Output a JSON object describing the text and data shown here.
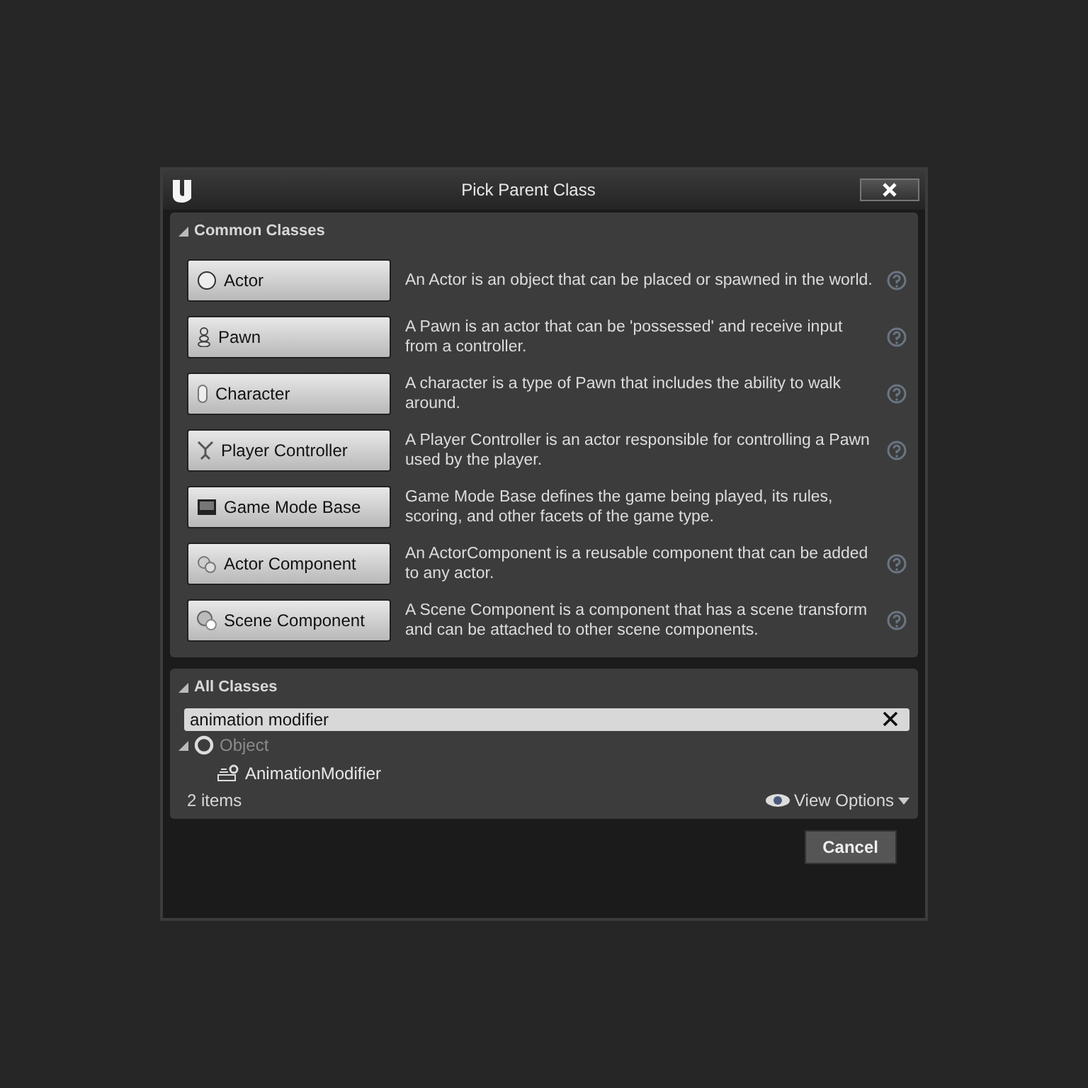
{
  "window": {
    "title": "Pick Parent Class"
  },
  "common_classes": {
    "title": "Common Classes",
    "expanded": true,
    "items": [
      {
        "label": "Actor",
        "description": "An Actor is an object that can be placed or spawned in the world.",
        "help": true
      },
      {
        "label": "Pawn",
        "description": "A Pawn is an actor that can be 'possessed' and receive input from a controller.",
        "help": true
      },
      {
        "label": "Character",
        "description": "A character is a type of Pawn that includes the ability to walk around.",
        "help": true
      },
      {
        "label": "Player Controller",
        "description": "A Player Controller is an actor responsible for controlling a Pawn used by the player.",
        "help": true
      },
      {
        "label": "Game Mode Base",
        "description": "Game Mode Base defines the game being played, its rules, scoring, and other facets of the game type.",
        "help": false
      },
      {
        "label": "Actor Component",
        "description": "An ActorComponent is a reusable component that can be added to any actor.",
        "help": true
      },
      {
        "label": "Scene Component",
        "description": "A Scene Component is a component that has a scene transform and can be attached to other scene components.",
        "help": true
      }
    ]
  },
  "all_classes": {
    "title": "All Classes",
    "expanded": true,
    "search": {
      "value": "animation modifier"
    },
    "tree": [
      {
        "label": "Object",
        "disabled": true,
        "expanded": true,
        "children": [
          {
            "label": "AnimationModifier",
            "disabled": false
          }
        ]
      }
    ],
    "count": "2 items",
    "view_options": "View Options"
  },
  "buttons": [
    {
      "label": "Cancel"
    }
  ]
}
